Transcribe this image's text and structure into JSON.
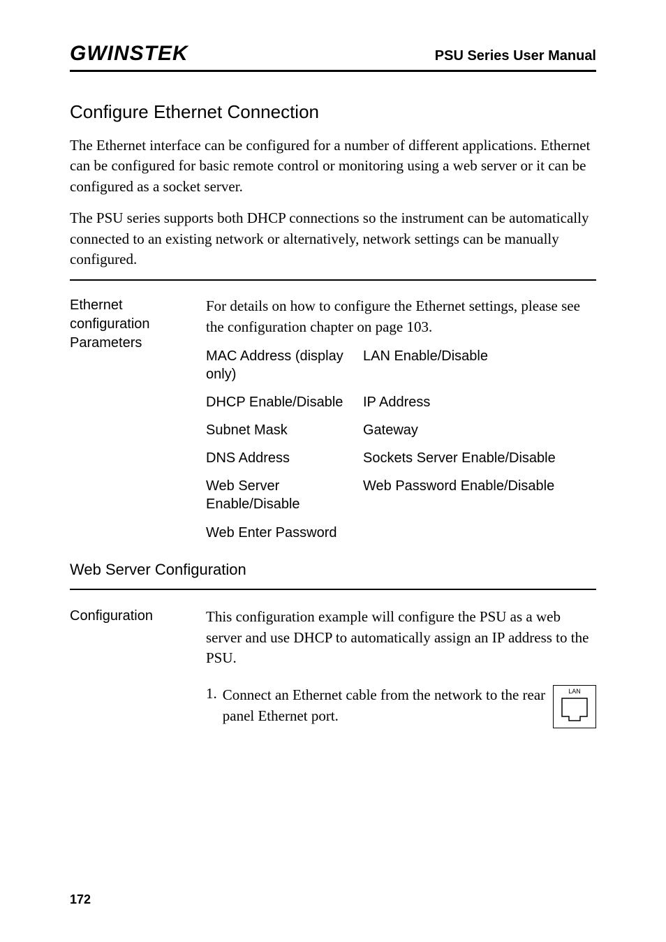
{
  "header": {
    "logo": "GWINSTEK",
    "manual_title": "PSU Series User Manual"
  },
  "section": {
    "heading": "Configure Ethernet Connection",
    "para1": "The Ethernet interface can be configured for a number of different applications. Ethernet can be configured for basic remote control or monitoring using a web server or it can be configured as a socket server.",
    "para2": "The PSU series supports both DHCP connections so the instrument can be automatically connected to an existing network or alternatively, network settings can be manually configured."
  },
  "params": {
    "label": "Ethernet configuration Parameters",
    "intro": "For details on how to configure the Ethernet settings, please see the configuration chapter on page 103.",
    "rows": [
      {
        "c1": "MAC Address (display only)",
        "c2": "LAN Enable/Disable"
      },
      {
        "c1": "DHCP Enable/Disable",
        "c2": "IP Address"
      },
      {
        "c1": "Subnet Mask",
        "c2": "Gateway"
      },
      {
        "c1": "DNS Address",
        "c2": "Sockets Server Enable/Disable"
      },
      {
        "c1": "Web Server Enable/Disable",
        "c2": "Web Password Enable/Disable"
      }
    ],
    "last_row": "Web Enter Password"
  },
  "subsection": {
    "heading": "Web Server Configuration"
  },
  "config": {
    "label": "Configuration",
    "text": "This configuration example will configure the PSU as a web server and use DHCP to automatically assign an IP address to the PSU."
  },
  "step": {
    "num": "1.",
    "text": "Connect an Ethernet cable from the network to the rear panel Ethernet port.",
    "lan_label": "LAN"
  },
  "page_number": "172"
}
